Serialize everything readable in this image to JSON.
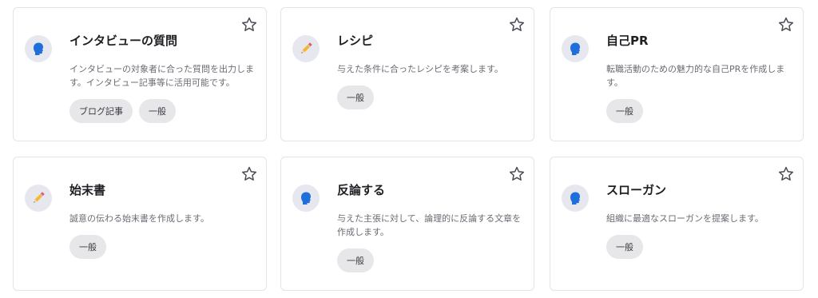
{
  "cards": [
    {
      "title": "インタビューの質問",
      "description": "インタビューの対象者に合った質問を出力します。インタビュー記事等に活用可能です。",
      "icon": "speaking-head-icon",
      "tags": [
        "ブログ記事",
        "一般"
      ]
    },
    {
      "title": "レシピ",
      "description": "与えた条件に合ったレシピを考案します。",
      "icon": "pencil-icon",
      "tags": [
        "一般"
      ]
    },
    {
      "title": "自己PR",
      "description": "転職活動のための魅力的な自己PRを作成します。",
      "icon": "speaking-head-icon",
      "tags": [
        "一般"
      ]
    },
    {
      "title": "始末書",
      "description": "誠意の伝わる始末書を作成します。",
      "icon": "pencil-icon",
      "tags": [
        "一般"
      ]
    },
    {
      "title": "反論する",
      "description": "与えた主張に対して、論理的に反論する文章を作成します。",
      "icon": "speaking-head-icon",
      "tags": [
        "一般"
      ]
    },
    {
      "title": "スローガン",
      "description": "組織に最適なスローガンを提案します。",
      "icon": "speaking-head-icon",
      "tags": [
        "一般"
      ]
    }
  ],
  "colors": {
    "head_icon": "#1e6fd9",
    "pencil_body": "#f5b833",
    "pencil_tip": "#e45b6a"
  }
}
